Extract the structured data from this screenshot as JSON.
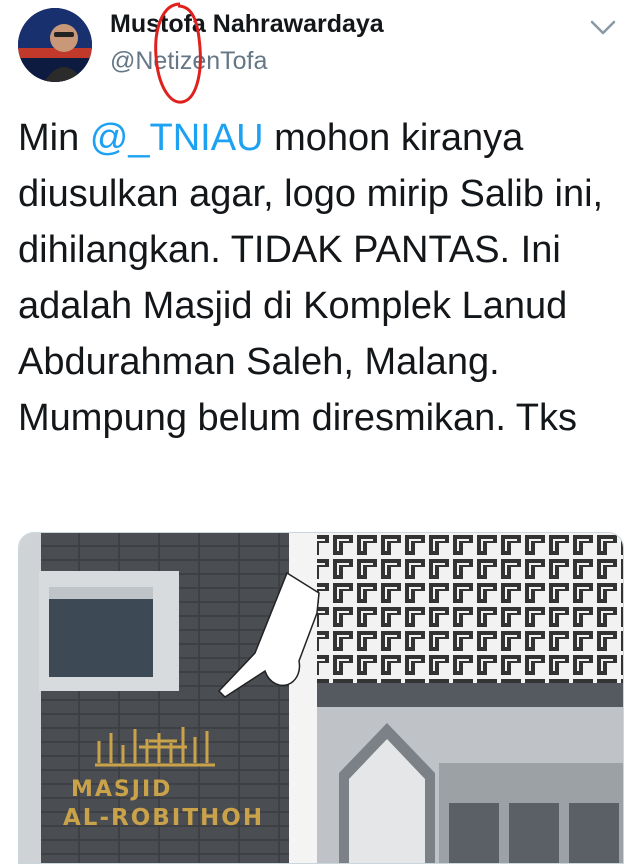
{
  "tweet": {
    "author_name": "Mustofa Nahrawardaya",
    "author_handle": "@NetizenTofa",
    "text_before": "Min ",
    "mention": "@_TNIAU",
    "text_after": " mohon kiranya diusulkan agar, logo mirip Salib ini, dihilangkan. TIDAK PANTAS. Ini adalah Masjid di Komplek Lanud Abdurahman Saleh, Malang. Mumpung belum diresmikan. Tks"
  },
  "media": {
    "sign_line1": "MASJID",
    "sign_line2": "AL-ROBITHOH"
  },
  "colors": {
    "mention": "#1da1f2",
    "handle": "#657786",
    "annotation": "#e0201c",
    "sign_gold": "#c9a24a"
  },
  "icons": [
    "avatar",
    "chevron-down-icon",
    "red-circle-annotation",
    "pointing-hand-drawing"
  ]
}
